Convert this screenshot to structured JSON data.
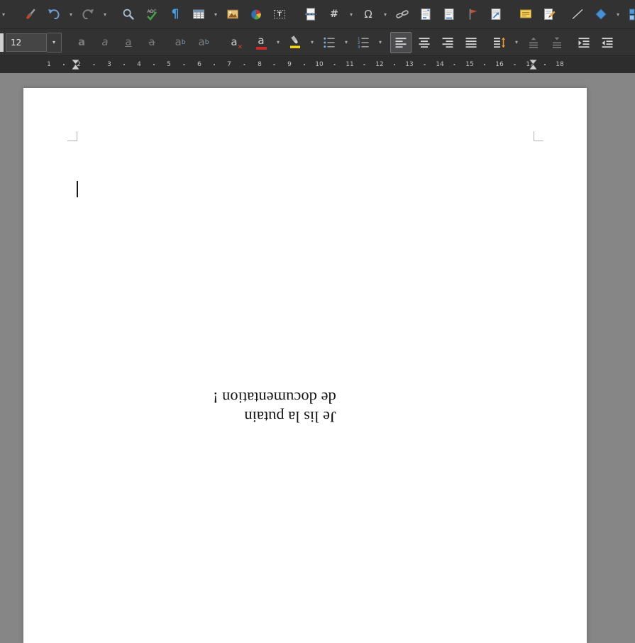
{
  "app": {
    "name": "LibreOffice Writer document window"
  },
  "icons": {
    "chevron_down": "▾"
  },
  "toolbar_standard": {
    "items": [
      {
        "name": "clone-formatting",
        "icon": "paintbrush-icon"
      },
      {
        "name": "undo",
        "icon": "undo-arrow-icon",
        "dropdown": true
      },
      {
        "name": "redo",
        "icon": "redo-arrow-icon",
        "dropdown": true,
        "disabled": true
      },
      {
        "name": "find-and-replace",
        "icon": "magnifier-icon"
      },
      {
        "name": "spelling-check",
        "icon": "spellcheck-icon",
        "glyph": "ABC"
      },
      {
        "name": "formatting-marks",
        "icon": "pilcrow-icon",
        "glyph": "¶"
      },
      {
        "name": "insert-table",
        "icon": "table-grid-icon",
        "dropdown": true
      },
      {
        "name": "insert-image",
        "icon": "picture-icon"
      },
      {
        "name": "insert-chart",
        "icon": "pie-chart-icon"
      },
      {
        "name": "insert-text-box",
        "icon": "text-box-icon",
        "glyph": "T"
      },
      {
        "name": "insert-page-break",
        "icon": "page-break-icon"
      },
      {
        "name": "insert-field",
        "icon": "hash-icon",
        "glyph": "#",
        "dropdown": true
      },
      {
        "name": "insert-special-character",
        "icon": "omega-icon",
        "glyph": "Ω",
        "dropdown": true
      },
      {
        "name": "insert-hyperlink",
        "icon": "chain-link-icon"
      },
      {
        "name": "insert-footnote",
        "icon": "footnote-page-icon"
      },
      {
        "name": "insert-endnote",
        "icon": "endnote-page-icon"
      },
      {
        "name": "insert-bookmark",
        "icon": "bookmark-flag-icon"
      },
      {
        "name": "insert-cross-reference",
        "icon": "cross-reference-icon"
      },
      {
        "name": "insert-comment",
        "icon": "comment-note-icon"
      },
      {
        "name": "track-changes",
        "icon": "track-changes-icon"
      },
      {
        "name": "insert-line",
        "icon": "diagonal-line-icon"
      },
      {
        "name": "basic-shapes",
        "icon": "diamond-shape-icon",
        "dropdown": true
      },
      {
        "name": "gallery",
        "icon": "gallery-grid-icon"
      }
    ]
  },
  "toolbar_formatting": {
    "font_size": "12",
    "items": [
      {
        "name": "bold",
        "glyph": "a",
        "disabled": true
      },
      {
        "name": "italic",
        "glyph": "a",
        "disabled": true
      },
      {
        "name": "underline",
        "glyph": "a",
        "disabled": true
      },
      {
        "name": "strikethrough",
        "glyph": "a",
        "disabled": true
      },
      {
        "name": "superscript",
        "glyph": "a",
        "sup": "b",
        "disabled": true
      },
      {
        "name": "subscript",
        "glyph": "a",
        "sub": "b",
        "disabled": true
      },
      {
        "name": "clear-direct-formatting",
        "glyph": "a",
        "x_mark": "✕"
      },
      {
        "name": "font-color",
        "glyph": "a",
        "color": "#cc2a2a",
        "dropdown": true
      },
      {
        "name": "highlighting-color",
        "icon": "highlighter-icon",
        "color": "#f3d211",
        "dropdown": true
      },
      {
        "name": "unordered-list",
        "icon": "bullet-list-icon",
        "dropdown": true
      },
      {
        "name": "ordered-list",
        "icon": "numbered-list-icon",
        "glyphs": [
          "1",
          "2",
          "3"
        ],
        "dropdown": true
      },
      {
        "name": "align-left",
        "icon": "align-left-icon",
        "active": true
      },
      {
        "name": "align-center",
        "icon": "align-center-icon"
      },
      {
        "name": "align-right",
        "icon": "align-right-icon"
      },
      {
        "name": "justified",
        "icon": "justify-icon"
      },
      {
        "name": "line-spacing",
        "icon": "line-spacing-icon",
        "dropdown": true
      },
      {
        "name": "increase-paragraph-spacing",
        "icon": "increase-paragraph-spacing-icon",
        "disabled": true
      },
      {
        "name": "decrease-paragraph-spacing",
        "icon": "decrease-paragraph-spacing-icon",
        "disabled": true
      },
      {
        "name": "increase-indent",
        "icon": "increase-indent-icon"
      },
      {
        "name": "decrease-indent",
        "icon": "decrease-indent-icon"
      }
    ]
  },
  "ruler": {
    "numbers": [
      "1",
      "2",
      "3",
      "4",
      "5",
      "6",
      "7",
      "8",
      "9",
      "10",
      "11",
      "12",
      "13",
      "14",
      "15",
      "16",
      "17",
      "18"
    ]
  },
  "document": {
    "paragraph": {
      "rotation_deg": 180,
      "lines": [
        "Je lis la putain",
        "de documentation !"
      ]
    }
  },
  "colors": {
    "toolbar_bg": "#323232",
    "ruler_bg": "#2d2d2d",
    "workspace_bg": "#868686",
    "page_bg": "#ffffff",
    "font_color_accent": "#cc2a2a",
    "highlight_accent": "#f3d211",
    "pilcrow_blue": "#4a9fe3"
  }
}
